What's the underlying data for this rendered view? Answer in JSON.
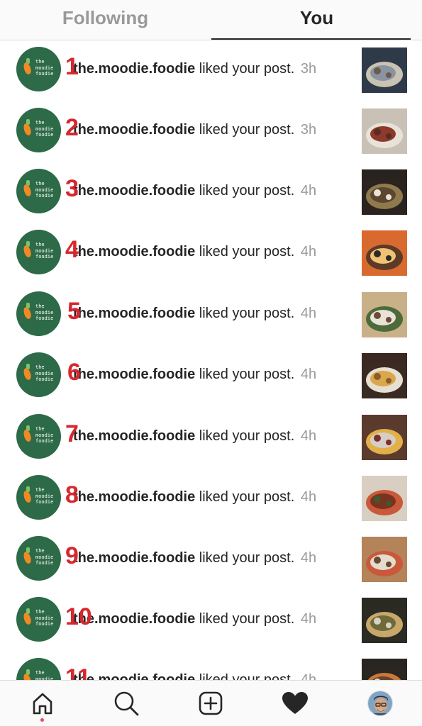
{
  "tabs": {
    "following": "Following",
    "you": "You",
    "active": "you"
  },
  "avatar_logo": {
    "line1": "the",
    "line2": "moodie",
    "line3": "foodie"
  },
  "notifications": [
    {
      "number": "1",
      "username": "the.moodie.foodie",
      "action": "liked your post.",
      "time": "3h"
    },
    {
      "number": "2",
      "username": "the.moodie.foodie",
      "action": "liked your post.",
      "time": "3h"
    },
    {
      "number": "3",
      "username": "the.moodie.foodie",
      "action": "liked your post.",
      "time": "4h"
    },
    {
      "number": "4",
      "username": "the.moodie.foodie",
      "action": "liked your post.",
      "time": "4h"
    },
    {
      "number": "5",
      "username": "the.moodie.foodie",
      "action": "liked your post.",
      "time": "4h"
    },
    {
      "number": "6",
      "username": "the.moodie.foodie",
      "action": "liked your post.",
      "time": "4h"
    },
    {
      "number": "7",
      "username": "the.moodie.foodie",
      "action": "liked your post.",
      "time": "4h"
    },
    {
      "number": "8",
      "username": "the.moodie.foodie",
      "action": "liked your post.",
      "time": "4h"
    },
    {
      "number": "9",
      "username": "the.moodie.foodie",
      "action": "liked your post.",
      "time": "4h"
    },
    {
      "number": "10",
      "username": "the.moodie.foodie",
      "action": "liked your post.",
      "time": "4h"
    },
    {
      "number": "11",
      "username": "the.moodie.foodie",
      "action": "liked your post.",
      "time": "4h"
    }
  ],
  "bottom_nav": {
    "items": [
      "home-icon",
      "search-icon",
      "new-post-icon",
      "activity-heart-icon",
      "profile-avatar"
    ],
    "active": "activity-heart-icon"
  },
  "colors": {
    "accent_number": "#d6282e",
    "avatar_bg": "#2d6a47",
    "muted_text": "#999999",
    "notification_dot": "#ed4956"
  }
}
